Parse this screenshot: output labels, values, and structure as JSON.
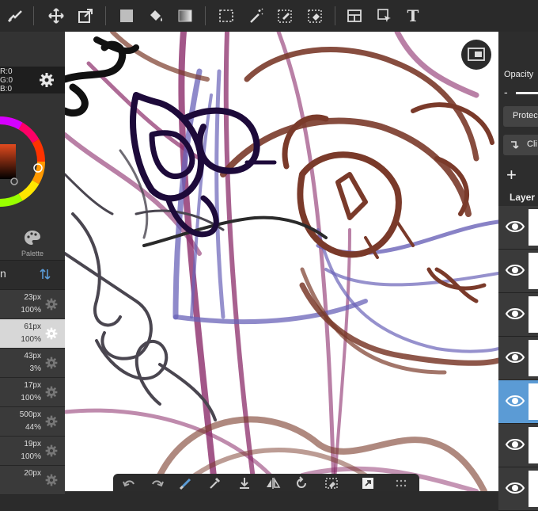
{
  "toolbar": {
    "tools": [
      {
        "icon": "pen-check-icon"
      },
      {
        "icon": "move-icon"
      },
      {
        "icon": "transform-icon"
      },
      {
        "icon": "fill-color-icon"
      },
      {
        "icon": "bucket-icon"
      },
      {
        "icon": "gradient-icon"
      },
      {
        "icon": "select-rect-icon"
      },
      {
        "icon": "magic-wand-icon"
      },
      {
        "icon": "select-pen-icon"
      },
      {
        "icon": "select-eraser-icon"
      },
      {
        "icon": "frame-icon"
      },
      {
        "icon": "select-arrow-icon"
      },
      {
        "icon": "text-icon"
      }
    ],
    "text_tool_label": "T"
  },
  "color": {
    "r_label": "R:0",
    "g_label": "G:0",
    "b_label": "B:0",
    "current": "#000000"
  },
  "palette_label": "Palette",
  "brush_header": {
    "left": "n"
  },
  "brushes": [
    {
      "size": "23px",
      "opacity": "100%"
    },
    {
      "size": "61px",
      "opacity": "100%",
      "selected": true
    },
    {
      "size": "43px",
      "opacity": "3%"
    },
    {
      "size": "17px",
      "opacity": "100%"
    },
    {
      "size": "500px",
      "opacity": "44%"
    },
    {
      "size": "19px",
      "opacity": "100%"
    },
    {
      "size": "20px",
      "opacity": ""
    }
  ],
  "layers_panel": {
    "opacity_label": "Opacity",
    "minus": "-",
    "protect_label": "Protec",
    "clip_label": "Cli",
    "add_label": "+",
    "layer_title": "Layer",
    "layers": [
      {
        "visible": true
      },
      {
        "visible": true
      },
      {
        "visible": true
      },
      {
        "visible": true
      },
      {
        "visible": true,
        "selected": true
      },
      {
        "visible": true
      },
      {
        "visible": true
      }
    ]
  },
  "bottom_bar": {
    "tools": [
      "undo-icon",
      "redo-icon",
      "brush-icon",
      "eyedropper-icon",
      "download-icon",
      "flip-icon",
      "rotate-icon",
      "eraser-icon",
      "fullscreen-icon",
      "more-icon"
    ]
  },
  "colors": {
    "accent_blue": "#5b9bd5",
    "stroke_brown": "#7a3a2a",
    "stroke_purple": "#8b2c6a",
    "stroke_navy": "#1d0a3a",
    "stroke_lavender": "#6a63b8"
  }
}
